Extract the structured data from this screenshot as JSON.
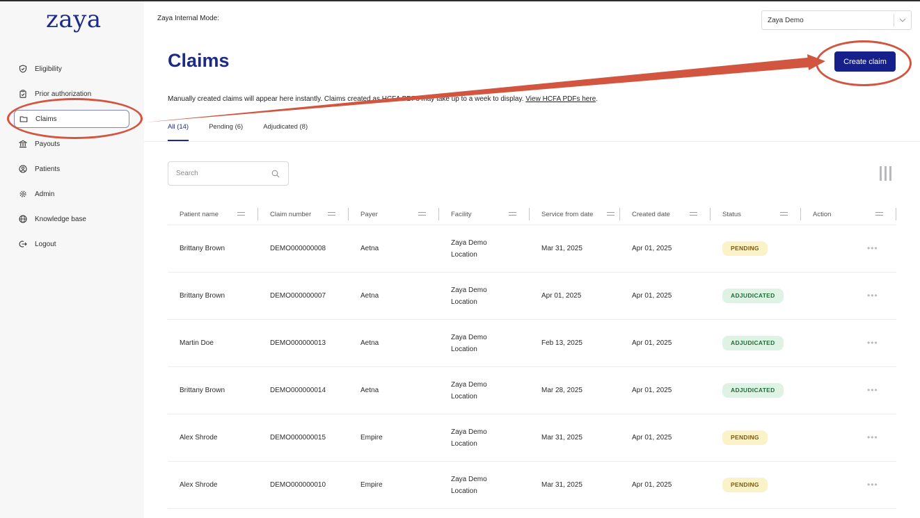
{
  "app": {
    "logo_text": "zaya"
  },
  "sidebar": {
    "items": [
      {
        "label": "Eligibility",
        "icon": "shield-check-icon",
        "active": false
      },
      {
        "label": "Prior authorization",
        "icon": "clipboard-check-icon",
        "active": false
      },
      {
        "label": "Claims",
        "icon": "folder-icon",
        "active": true
      },
      {
        "label": "Payouts",
        "icon": "bank-icon",
        "active": false
      },
      {
        "label": "Patients",
        "icon": "user-circle-icon",
        "active": false
      },
      {
        "label": "Admin",
        "icon": "gear-icon",
        "active": false
      },
      {
        "label": "Knowledge base",
        "icon": "globe-icon",
        "active": false
      },
      {
        "label": "Logout",
        "icon": "logout-icon",
        "active": false
      }
    ]
  },
  "header": {
    "mode_label": "Zaya Internal Mode:",
    "org_select": {
      "value": "Zaya Demo"
    }
  },
  "page": {
    "title": "Claims",
    "create_button": "Create claim",
    "notice_text": "Manually created claims will appear here instantly. Claims created as HCFA PDFs may take up to a week to display.",
    "notice_link": "View HCFA PDFs here",
    "tabs": [
      {
        "label": "All (14)",
        "active": true
      },
      {
        "label": "Pending (6)",
        "active": false
      },
      {
        "label": "Adjudicated (8)",
        "active": false
      }
    ],
    "search": {
      "placeholder": "Search"
    }
  },
  "table": {
    "columns": [
      "Patient name",
      "Claim number",
      "Payer",
      "Facility",
      "Service from date",
      "Created date",
      "Status",
      "Action"
    ],
    "rows": [
      {
        "patient": "Brittany Brown",
        "claim": "DEMO000000008",
        "payer": "Aetna",
        "facility_1": "Zaya Demo",
        "facility_2": "Location",
        "service_date": "Mar 31, 2025",
        "created": "Apr 01, 2025",
        "status": "PENDING"
      },
      {
        "patient": "Brittany Brown",
        "claim": "DEMO000000007",
        "payer": "Aetna",
        "facility_1": "Zaya Demo",
        "facility_2": "Location",
        "service_date": "Apr 01, 2025",
        "created": "Apr 01, 2025",
        "status": "ADJUDICATED"
      },
      {
        "patient": "Martin Doe",
        "claim": "DEMO000000013",
        "payer": "Aetna",
        "facility_1": "Zaya Demo",
        "facility_2": "Location",
        "service_date": "Feb 13, 2025",
        "created": "Apr 01, 2025",
        "status": "ADJUDICATED"
      },
      {
        "patient": "Brittany Brown",
        "claim": "DEMO000000014",
        "payer": "Aetna",
        "facility_1": "Zaya Demo",
        "facility_2": "Location",
        "service_date": "Mar 28, 2025",
        "created": "Apr 01, 2025",
        "status": "ADJUDICATED"
      },
      {
        "patient": "Alex Shrode",
        "claim": "DEMO000000015",
        "payer": "Empire",
        "facility_1": "Zaya Demo",
        "facility_2": "Location",
        "service_date": "Mar 31, 2025",
        "created": "Apr 01, 2025",
        "status": "PENDING"
      },
      {
        "patient": "Alex Shrode",
        "claim": "DEMO000000010",
        "payer": "Empire",
        "facility_1": "Zaya Demo",
        "facility_2": "Location",
        "service_date": "Mar 31, 2025",
        "created": "Apr 01, 2025",
        "status": "PENDING"
      }
    ],
    "action_icon": "more-horizontal-icon"
  },
  "annotations": {
    "highlight_color": "#d2553f"
  },
  "colors": {
    "brand": "#1d2a86",
    "button": "#15208a"
  }
}
